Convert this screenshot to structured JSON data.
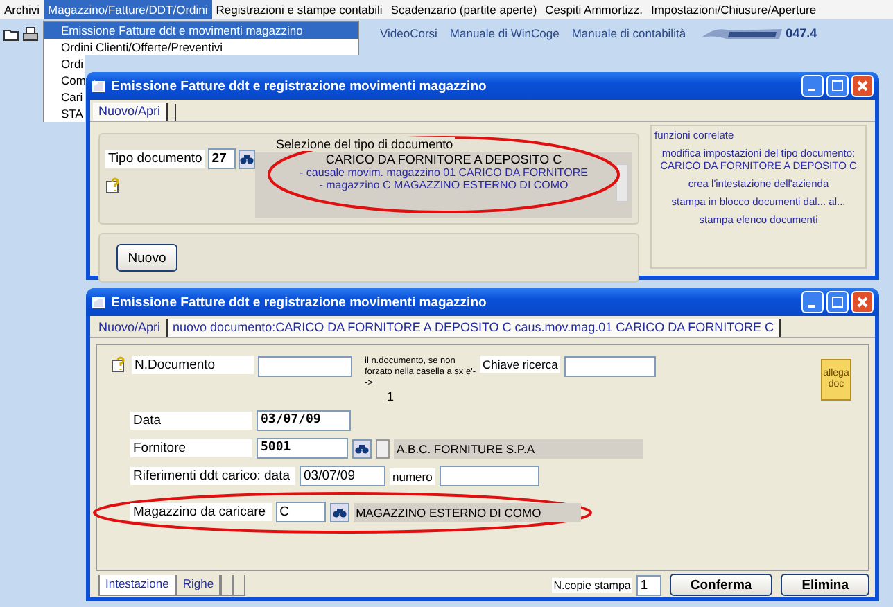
{
  "menu_bar": {
    "items": [
      {
        "label": "Archivi",
        "selected": false
      },
      {
        "label": "Magazzino/Fatture/DDT/Ordini",
        "selected": true
      },
      {
        "label": "Registrazioni e stampe contabili",
        "selected": false
      },
      {
        "label": "Scadenzario (partite aperte)",
        "selected": false
      },
      {
        "label": "Cespiti Ammortizz.",
        "selected": false
      },
      {
        "label": "Impostazioni/Chiusure/Aperture",
        "selected": false
      }
    ]
  },
  "toolbar": {
    "links": [
      "VideoCorsi",
      "Manuale di WinCoge",
      "Manuale di contabilità"
    ],
    "version": "047.4"
  },
  "dropdown": {
    "items": [
      {
        "label": "Emissione Fatture ddt e movimenti magazzino",
        "selected": true
      },
      {
        "label": "Ordini Clienti/Offerte/Preventivi",
        "selected": false
      },
      {
        "label": "Ordi",
        "selected": false
      },
      {
        "label": "Com",
        "selected": false
      },
      {
        "label": "Cari",
        "selected": false
      },
      {
        "label": "STA",
        "selected": false
      }
    ]
  },
  "window_1": {
    "title": "Emissione Fatture ddt e registrazione movimenti magazzino",
    "tabs": [
      {
        "label": "Nuovo/Apri",
        "selected": true
      }
    ],
    "document_type": {
      "label": "Tipo documento",
      "value": "27"
    },
    "selection": {
      "heading": "Selezione del tipo di documento",
      "title": "CARICO DA FORNITORE A DEPOSITO C",
      "lines": [
        "- causale movim. magazzino 01 CARICO DA FORNITORE",
        "- magazzino C MAGAZZINO ESTERNO DI COMO"
      ]
    },
    "new_button": "Nuovo",
    "related": {
      "title": "funzioni correlate",
      "links": [
        "modifica impostazioni del tipo documento: CARICO DA FORNITORE A DEPOSITO C",
        "crea l'intestazione dell'azienda",
        "stampa in blocco documenti dal... al...",
        "stampa elenco documenti"
      ]
    }
  },
  "window_2": {
    "title": "Emissione Fatture ddt e registrazione movimenti magazzino",
    "tabs": [
      {
        "label": "Nuovo/Apri",
        "selected": false
      },
      {
        "label": "nuovo documento:CARICO DA FORNITORE A DEPOSITO C caus.mov.mag.01 CARICO DA FORNITORE C",
        "selected": true
      }
    ],
    "doc_number": {
      "label": "N.Documento"
    },
    "doc_note": "il n.documento, se non forzato nella casella a sx e'-->",
    "doc_note_value": "1",
    "search_key": {
      "label": "Chiave ricerca"
    },
    "date": {
      "label": "Data",
      "value": "03/07/09"
    },
    "supplier": {
      "label": "Fornitore",
      "value": "5001",
      "name": "A.B.C. FORNITURE S.P.A"
    },
    "ddt_ref": {
      "label": "Riferimenti ddt carico:  data",
      "date": "03/07/09",
      "number_label": "numero"
    },
    "warehouse": {
      "label": "Magazzino da caricare",
      "value": "C",
      "name": "MAGAZZINO ESTERNO DI COMO"
    },
    "attach": "allega doc",
    "bottom_tabs": [
      {
        "label": "Intestazione",
        "selected": true
      },
      {
        "label": "Righe",
        "selected": false
      }
    ],
    "copies": {
      "label": "N.copie stampa",
      "value": "1"
    },
    "buttons": [
      "Conferma",
      "Elimina"
    ]
  }
}
